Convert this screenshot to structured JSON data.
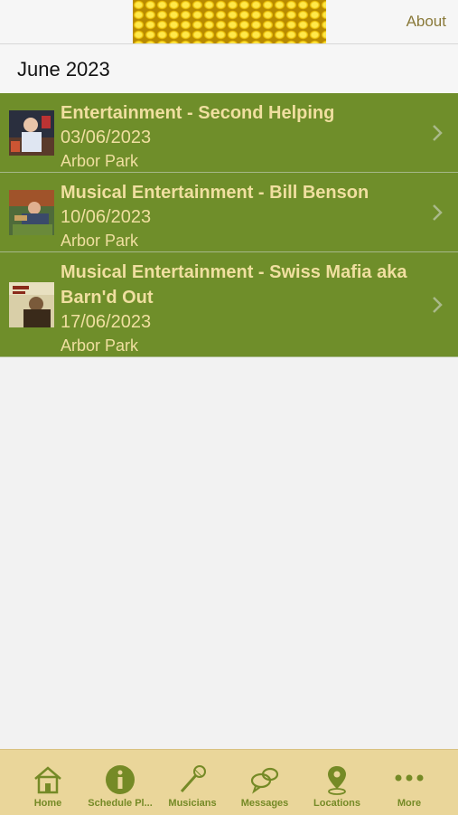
{
  "header": {
    "about_label": "About"
  },
  "section": {
    "title": "June 2023"
  },
  "events": [
    {
      "title": "Entertainment - Second Helping",
      "date": "03/06/2023",
      "location": "Arbor Park"
    },
    {
      "title": "Musical Entertainment - Bill Benson",
      "date": "10/06/2023",
      "location": "Arbor Park"
    },
    {
      "title": "Musical Entertainment - Swiss Mafia aka Barn'd Out",
      "date": "17/06/2023",
      "location": "Arbor Park"
    }
  ],
  "tabbar": {
    "tabs": [
      {
        "label": "Home",
        "icon": "home-icon"
      },
      {
        "label": "Schedule Pl...",
        "icon": "info-icon"
      },
      {
        "label": "Musicians",
        "icon": "microphone-icon"
      },
      {
        "label": "Messages",
        "icon": "chat-bubbles-icon"
      },
      {
        "label": "Locations",
        "icon": "map-pin-icon"
      },
      {
        "label": "More",
        "icon": "more-dots-icon"
      }
    ]
  },
  "colors": {
    "row_background": "#6f8e2a",
    "row_text": "#f0dfa0",
    "tabbar_background": "#ead69a",
    "tab_accent": "#758a26"
  }
}
